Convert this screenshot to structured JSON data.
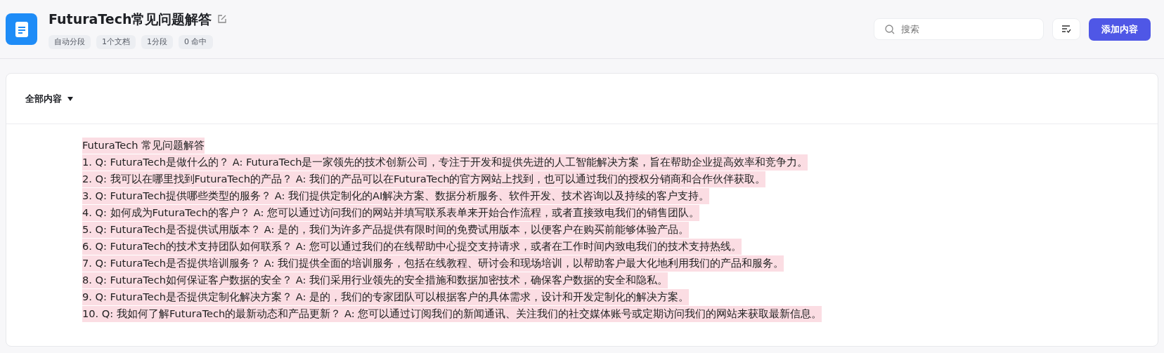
{
  "header": {
    "title": "FuturaTech常见问题解答",
    "tags": [
      "自动分段",
      "1个文档",
      "1分段",
      "0 命中"
    ]
  },
  "search": {
    "placeholder": "搜索"
  },
  "add_button": "添加内容",
  "filter": {
    "label": "全部内容"
  },
  "lines": [
    {
      "text": "FuturaTech 常见问题解答",
      "highlighted": true
    },
    {
      "text": "1. Q: FuturaTech是做什么的？  A: FuturaTech是一家领先的技术创新公司，专注于开发和提供先进的人工智能解决方案，旨在帮助企业提高效率和竞争力。",
      "highlighted": true
    },
    {
      "text": "2. Q: 我可以在哪里找到FuturaTech的产品？  A: 我们的产品可以在FuturaTech的官方网站上找到，也可以通过我们的授权分销商和合作伙伴获取。",
      "highlighted": true
    },
    {
      "text": "3. Q: FuturaTech提供哪些类型的服务？  A: 我们提供定制化的AI解决方案、数据分析服务、软件开发、技术咨询以及持续的客户支持。",
      "highlighted": true
    },
    {
      "text": "4. Q: 如何成为FuturaTech的客户？  A: 您可以通过访问我们的网站并填写联系表单来开始合作流程，或者直接致电我们的销售团队。",
      "highlighted": true
    },
    {
      "text": "5. Q: FuturaTech是否提供试用版本？  A: 是的，我们为许多产品提供有限时间的免费试用版本，以便客户在购买前能够体验产品。",
      "highlighted": true
    },
    {
      "text": "6. Q: FuturaTech的技术支持团队如何联系？  A: 您可以通过我们的在线帮助中心提交支持请求，或者在工作时间内致电我们的技术支持热线。",
      "highlighted": true
    },
    {
      "text": "7. Q: FuturaTech是否提供培训服务？  A: 我们提供全面的培训服务，包括在线教程、研讨会和现场培训，以帮助客户最大化地利用我们的产品和服务。",
      "highlighted": true
    },
    {
      "text": "8. Q: FuturaTech如何保证客户数据的安全？  A: 我们采用行业领先的安全措施和数据加密技术，确保客户数据的安全和隐私。",
      "highlighted": true
    },
    {
      "text": "9. Q: FuturaTech是否提供定制化解决方案？  A: 是的，我们的专家团队可以根据客户的具体需求，设计和开发定制化的解决方案。",
      "highlighted": true
    },
    {
      "text": "10. Q: 我如何了解FuturaTech的最新动态和产品更新？  A: 您可以通过订阅我们的新闻通讯、关注我们的社交媒体账号或定期访问我们的网站来获取最新信息。",
      "highlighted": true
    }
  ]
}
